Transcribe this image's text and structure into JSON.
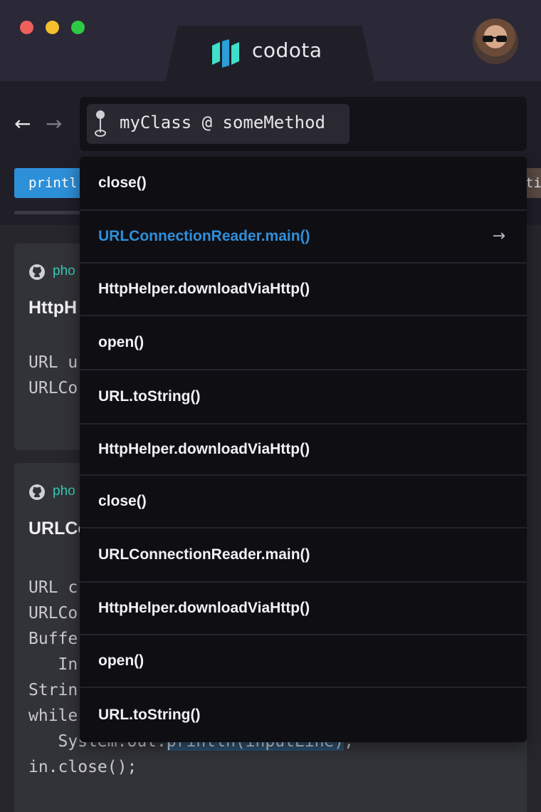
{
  "window": {
    "brand": "codota",
    "logo_colors": [
      "#3fe0c9",
      "#2a9fd8"
    ]
  },
  "nav": {
    "back_icon": "←",
    "forward_icon": "→",
    "search_query": "myClass @ someMethod",
    "tags": [
      {
        "label": "printl",
        "color": "#2d8fd8"
      },
      {
        "label": "ti",
        "color": "#5a4a44"
      }
    ]
  },
  "results": [
    {
      "source": "pho",
      "title": "HttpH",
      "code": [
        "URL u",
        "URLCo"
      ]
    },
    {
      "source": "pho",
      "title": "URLCo",
      "code": [
        "URL c",
        "URLCo",
        "Buffe",
        "   In",
        "Strin",
        "while",
        "   System.out.",
        "println(inputLine)",
        ";",
        "in.close();"
      ]
    }
  ],
  "dropdown": {
    "arrow_icon": "→",
    "items": [
      "close()",
      "URLConnectionReader.main()",
      "HttpHelper.downloadViaHttp()",
      "open()",
      "URL.toString()",
      "HttpHelper.downloadViaHttp()",
      "close()",
      "URLConnectionReader.main()",
      "HttpHelper.downloadViaHttp()",
      "open()",
      "URL.toString()"
    ]
  }
}
